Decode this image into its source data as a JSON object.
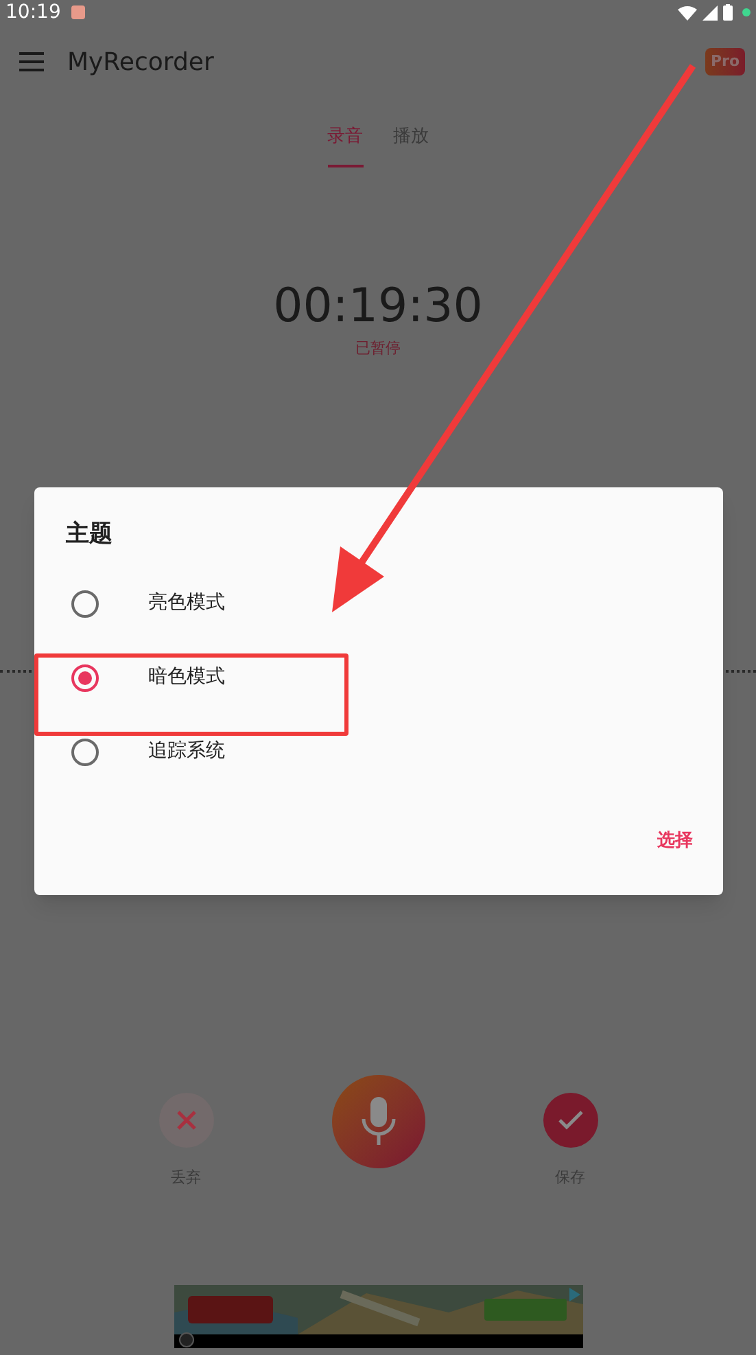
{
  "status_bar": {
    "time": "10:19"
  },
  "app_bar": {
    "title": "MyRecorder",
    "badge": "Pro"
  },
  "tabs": [
    {
      "label": "录音",
      "selected": true
    },
    {
      "label": "播放",
      "selected": false
    }
  ],
  "timer": {
    "elapsed": "00:19:30",
    "state": "已暂停"
  },
  "controls": {
    "discard": "丢弃",
    "save": "保存"
  },
  "dialog": {
    "title": "主题",
    "options": [
      {
        "label": "亮色模式",
        "selected": false
      },
      {
        "label": "暗色模式",
        "selected": true
      },
      {
        "label": "追踪系统",
        "selected": false
      }
    ],
    "button": "选择"
  }
}
